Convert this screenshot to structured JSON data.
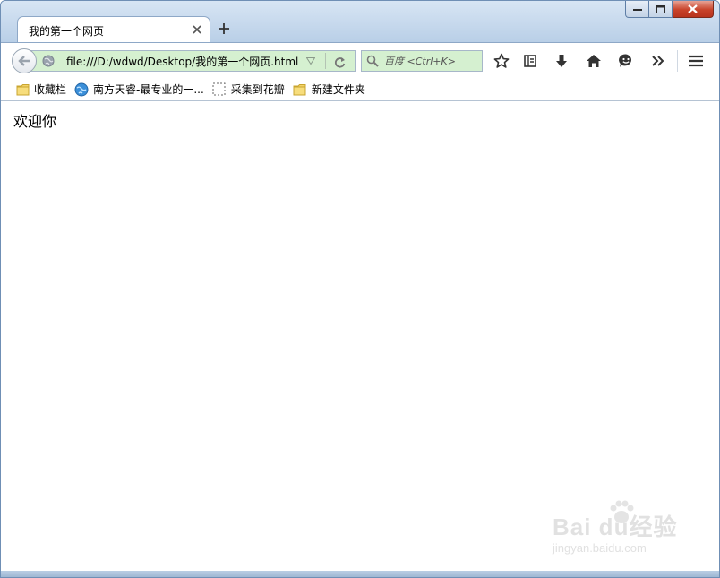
{
  "window": {
    "controls": {
      "minimize": "minimize",
      "maximize": "maximize",
      "close": "close"
    }
  },
  "tab": {
    "title": "我的第一个网页",
    "close_icon": "close-icon",
    "new_tab_icon": "plus-icon"
  },
  "navbar": {
    "url": "file:///D:/wdwd/Desktop/我的第一个网页.html",
    "search_placeholder": "百度 <Ctrl+K>",
    "toolbar_icons": [
      "star-icon",
      "reading-list-icon",
      "download-icon",
      "home-icon",
      "smiley-icon",
      "overflow-icon",
      "menu-icon"
    ]
  },
  "bookmarks": [
    {
      "label": "收藏栏",
      "icon": "folder-icon"
    },
    {
      "label": "南方天睿-最专业的一...",
      "icon": "globe-icon"
    },
    {
      "label": "采集到花瓣",
      "icon": "dashed-box-icon"
    },
    {
      "label": "新建文件夹",
      "icon": "folder-icon"
    }
  ],
  "content": {
    "text": "欢迎你"
  },
  "watermark": {
    "logo": "Bai du经验",
    "url": "jingyan.baidu.com"
  },
  "colors": {
    "url_bg": "#d5f0d0",
    "chrome_blue": "#a9c2df",
    "close_red": "#c8432a"
  }
}
